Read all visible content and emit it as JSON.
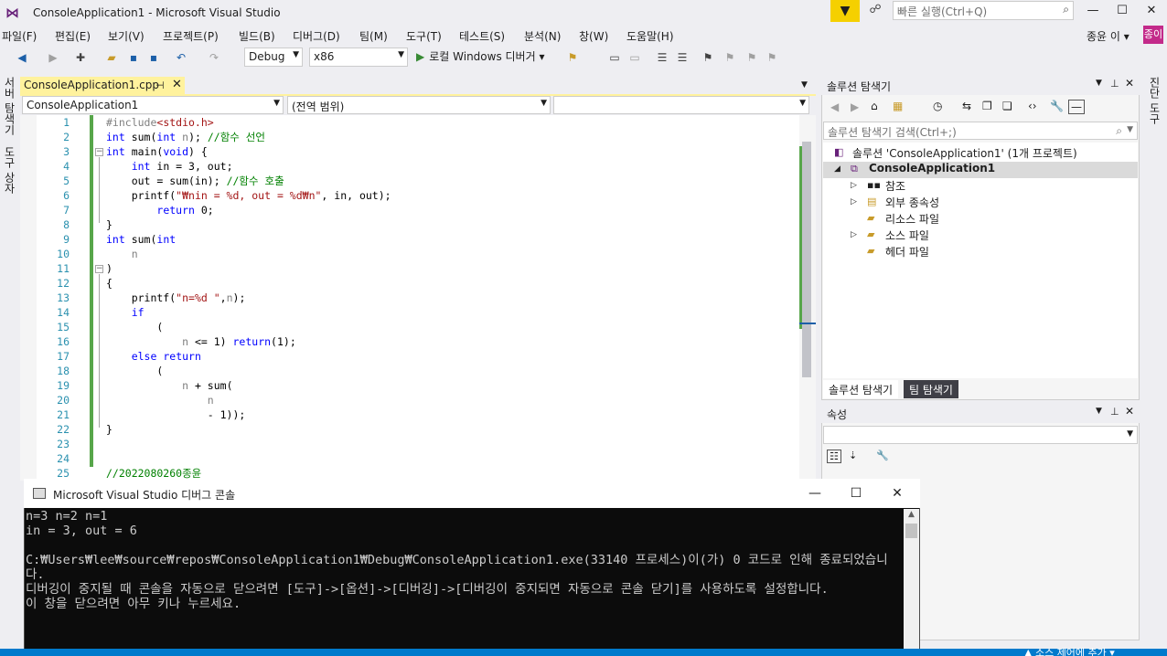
{
  "window": {
    "title": "ConsoleApplication1 - Microsoft Visual Studio",
    "quick_launch_placeholder": "빠른 실행(Ctrl+Q)",
    "min": "—",
    "max": "☐",
    "close": "✕"
  },
  "menu": {
    "items": [
      "파일(F)",
      "편집(E)",
      "보기(V)",
      "프로젝트(P)",
      "빌드(B)",
      "디버그(D)",
      "팀(M)",
      "도구(T)",
      "테스트(S)",
      "분석(N)",
      "창(W)",
      "도움말(H)"
    ],
    "user": "종윤 이 ▾",
    "avatar": "종이"
  },
  "toolbar": {
    "config": "Debug",
    "platform": "x86",
    "run_label": "로컬 Windows 디버거 ▾"
  },
  "left_rail": {
    "server_explorer": "서버 탐색기",
    "toolbox": "도구 상자"
  },
  "right_rail": {
    "diagnostics": "진단 도구"
  },
  "doc_tab": {
    "name": "ConsoleApplication1.cpp",
    "pin": "⊣",
    "close": "✕"
  },
  "navbar": {
    "project": "ConsoleApplication1",
    "scope": "(전역 범위)",
    "member": ""
  },
  "code": {
    "lines": [
      {
        "n": "1",
        "parts": [
          [
            "pp",
            "#include"
          ],
          [
            "str",
            "<stdio.h>"
          ]
        ]
      },
      {
        "n": "2",
        "parts": [
          [
            "kw",
            "int"
          ],
          [
            "tx",
            " sum("
          ],
          [
            "kw",
            "int"
          ],
          [
            "tx",
            " "
          ],
          [
            "id",
            "n"
          ],
          [
            "tx",
            "); "
          ],
          [
            "cm",
            "//함수 선언"
          ]
        ]
      },
      {
        "n": "3",
        "parts": [
          [
            "kw",
            "int"
          ],
          [
            "tx",
            " main("
          ],
          [
            "kw",
            "void"
          ],
          [
            "tx",
            ") {"
          ]
        ]
      },
      {
        "n": "4",
        "parts": [
          [
            "tx",
            "    "
          ],
          [
            "kw",
            "int"
          ],
          [
            "tx",
            " in = 3, out;"
          ]
        ]
      },
      {
        "n": "5",
        "parts": [
          [
            "tx",
            "    out = sum(in); "
          ],
          [
            "cm",
            "//함수 호출"
          ]
        ]
      },
      {
        "n": "6",
        "parts": [
          [
            "tx",
            "    printf("
          ],
          [
            "str",
            "\"₩nin = %d, out = %d₩n\""
          ],
          [
            "tx",
            ", in, out);"
          ]
        ]
      },
      {
        "n": "7",
        "parts": [
          [
            "tx",
            "        "
          ],
          [
            "kw",
            "return"
          ],
          [
            "tx",
            " 0;"
          ]
        ]
      },
      {
        "n": "8",
        "parts": [
          [
            "tx",
            "}"
          ]
        ]
      },
      {
        "n": "9",
        "parts": [
          [
            "kw",
            "int"
          ],
          [
            "tx",
            " sum("
          ],
          [
            "kw",
            "int"
          ]
        ]
      },
      {
        "n": "10",
        "parts": [
          [
            "tx",
            "    "
          ],
          [
            "id",
            "n"
          ]
        ]
      },
      {
        "n": "11",
        "parts": [
          [
            "tx",
            ")"
          ]
        ]
      },
      {
        "n": "12",
        "parts": [
          [
            "tx",
            "{"
          ]
        ]
      },
      {
        "n": "13",
        "parts": [
          [
            "tx",
            "    printf("
          ],
          [
            "str",
            "\"n=%d \""
          ],
          [
            "tx",
            ","
          ],
          [
            "id",
            "n"
          ],
          [
            "tx",
            ");"
          ]
        ]
      },
      {
        "n": "14",
        "parts": [
          [
            "tx",
            "    "
          ],
          [
            "kw",
            "if"
          ]
        ]
      },
      {
        "n": "15",
        "parts": [
          [
            "tx",
            "        ("
          ]
        ]
      },
      {
        "n": "16",
        "parts": [
          [
            "tx",
            "            "
          ],
          [
            "id",
            "n"
          ],
          [
            "tx",
            " <= 1) "
          ],
          [
            "kw",
            "return"
          ],
          [
            "tx",
            "(1);"
          ]
        ]
      },
      {
        "n": "17",
        "parts": [
          [
            "tx",
            "    "
          ],
          [
            "kw",
            "else"
          ],
          [
            "tx",
            " "
          ],
          [
            "kw",
            "return"
          ]
        ]
      },
      {
        "n": "18",
        "parts": [
          [
            "tx",
            "        ("
          ]
        ]
      },
      {
        "n": "19",
        "parts": [
          [
            "tx",
            "            "
          ],
          [
            "id",
            "n"
          ],
          [
            "tx",
            " + sum("
          ]
        ]
      },
      {
        "n": "20",
        "parts": [
          [
            "tx",
            "                "
          ],
          [
            "id",
            "n"
          ]
        ]
      },
      {
        "n": "21",
        "parts": [
          [
            "tx",
            "                - 1));"
          ]
        ]
      },
      {
        "n": "22",
        "parts": [
          [
            "tx",
            "}"
          ]
        ]
      },
      {
        "n": "23",
        "parts": []
      },
      {
        "n": "24",
        "parts": []
      },
      {
        "n": "25",
        "parts": [
          [
            "cm",
            "//2022080260종윤"
          ]
        ]
      }
    ]
  },
  "solution_explorer": {
    "title": "솔루션 탐색기",
    "search_placeholder": "솔루션 탐색기 검색(Ctrl+;)",
    "solution": "솔루션 'ConsoleApplication1' (1개 프로젝트)",
    "project": "ConsoleApplication1",
    "nodes": [
      "참조",
      "외부 종속성",
      "리소스 파일",
      "소스 파일",
      "헤더 파일"
    ],
    "tab_solution": "솔루션 탐색기",
    "tab_team": "팀 탐색기"
  },
  "properties": {
    "title": "속성"
  },
  "console": {
    "title": "Microsoft Visual Studio 디버그 콘솔",
    "output": "n=3 n=2 n=1\nin = 3, out = 6\n\nC:₩Users₩lee₩source₩repos₩ConsoleApplication1₩Debug₩ConsoleApplication1.exe(33140 프로세스)이(가) 0 코드로 인해 종료되었습니다.\n디버깅이 중지될 때 콘솔을 자동으로 닫으려면 [도구]->[옵션]->[디버깅]->[디버깅이 중지되면 자동으로 콘솔 닫기]를 사용하도록 설정합니다.\n이 창을 닫으려면 아무 키나 누르세요."
  },
  "status": {
    "source_control": "▲ 소스 제어에 추가 ▾"
  },
  "colors": {
    "keyword": "#0000ff",
    "string": "#a31515",
    "comment": "#008000",
    "accent": "#007acc",
    "tab_active": "#fff29d"
  }
}
